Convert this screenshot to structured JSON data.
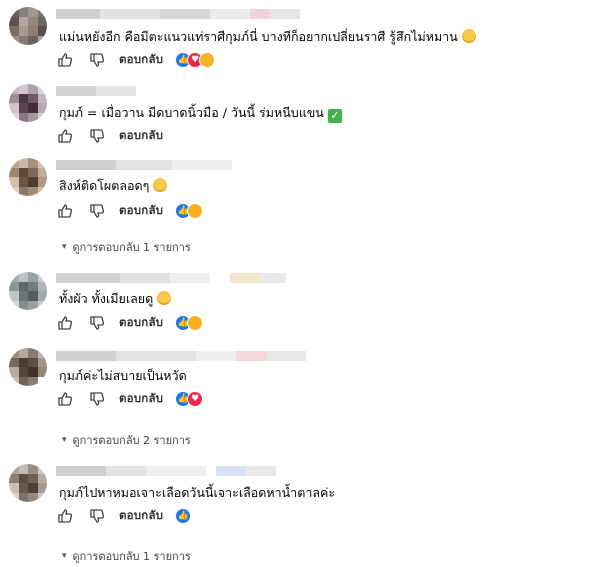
{
  "comments": [
    {
      "text": "แม่นหยังอีก คือมีตะแนวแท่ราศีกุมภ์นี่ บางทีก็อยากเปลี่ยนราศี รู้สึกไม่หมาน",
      "emoji": "eye-roll",
      "reply_label": "ตอบกลับ",
      "reactions": [
        "like",
        "love",
        "haha"
      ]
    },
    {
      "text": "กุมภ์ = เมื่อวาน มีดบาดนิ้วมือ / วันนี้ ร่มหนีบแขน",
      "emoji": "check-mark",
      "reply_label": "ตอบกลับ",
      "reactions": []
    },
    {
      "text": "สิงห์ติดโผตลอดๆ",
      "emoji": "grin",
      "reply_label": "ตอบกลับ",
      "reactions": [
        "like",
        "haha"
      ],
      "view_replies": "ดูการตอบกลับ 1 รายการ"
    },
    {
      "text": "ทั้งผัว ทั้งเมียเลยดู",
      "emoji": "grin",
      "reply_label": "ตอบกลับ",
      "reactions": [
        "like",
        "sad"
      ]
    },
    {
      "text": "กุมภ์ค่ะไม่สบายเป็นหวัด",
      "emoji": "",
      "reply_label": "ตอบกลับ",
      "reactions": [
        "like",
        "love"
      ],
      "view_replies": "ดูการตอบกลับ 2 รายการ"
    },
    {
      "text": "กุมภ์ไปหาหมอเจาะเลือดวันนี้เจาะเลือดหาน้ำตาลค่ะ",
      "emoji": "",
      "reply_label": "ตอบกลับ",
      "reactions": [
        "like"
      ],
      "view_replies": "ดูการตอบกลับ 1 รายการ"
    }
  ],
  "colors": {
    "like": "#1877f2",
    "love": "#f02849",
    "haha": "#f7b125",
    "text": "#050505",
    "muted": "#444444"
  }
}
